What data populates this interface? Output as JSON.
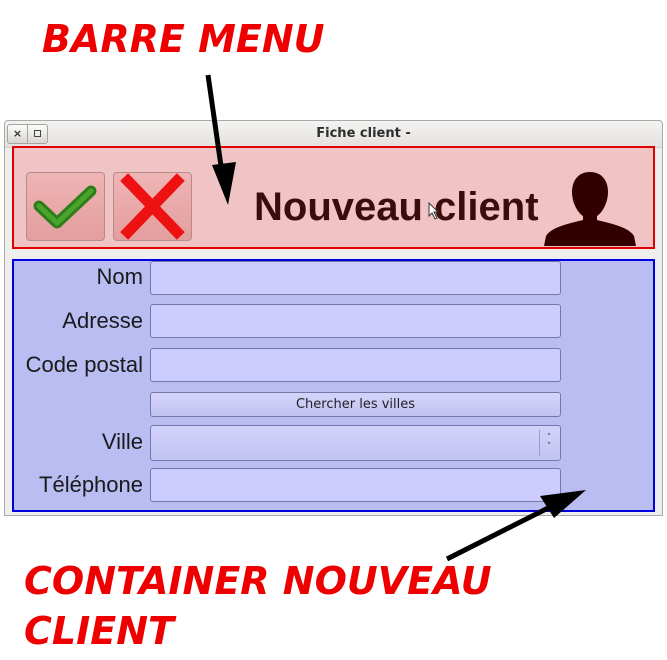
{
  "annotations": {
    "menu_bar_label": "BARRE MENU",
    "container_label_line1": "CONTAINER NOUVEAU",
    "container_label_line2": "CLIENT"
  },
  "window": {
    "title": "Fiche client -",
    "close_glyph": "×"
  },
  "menu_bar": {
    "title": "Nouveau client",
    "validate_icon": "checkmark-icon",
    "cancel_icon": "cross-icon",
    "user_icon": "user-silhouette-icon"
  },
  "form": {
    "fields": [
      {
        "label": "Nom",
        "value": "",
        "placeholder": ""
      },
      {
        "label": "Adresse",
        "value": "",
        "placeholder": ""
      },
      {
        "label": "Code postal",
        "value": "",
        "placeholder": ""
      },
      {
        "label": "Ville",
        "value": ""
      },
      {
        "label": "Téléphone",
        "value": "",
        "placeholder": ""
      }
    ],
    "search_cities_label": "Chercher les villes",
    "select_arrow_up": "˄",
    "select_arrow_down": "˅"
  },
  "colors": {
    "annotation": "#ee0000",
    "menu_bar_bg": "#f0c4c4",
    "menu_bar_border": "#e00000",
    "container_bg": "#b9bdf1",
    "container_border": "#0000dd",
    "input_bg": "#ccccff",
    "check_green": "#2e7d1b",
    "cross_red": "#ee1111"
  }
}
